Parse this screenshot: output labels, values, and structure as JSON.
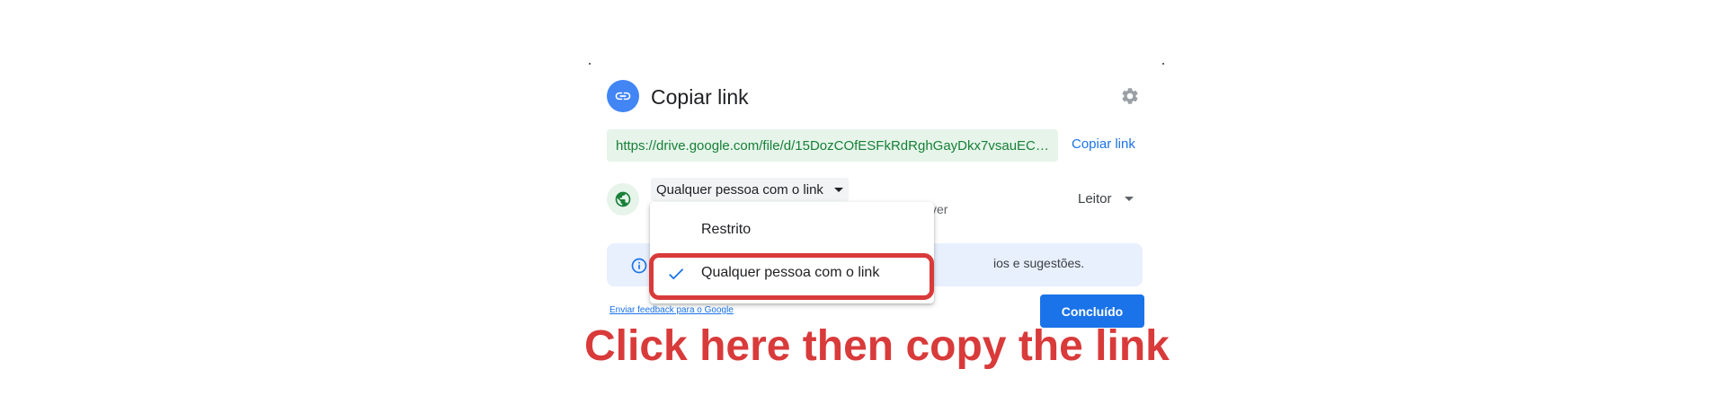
{
  "dialog": {
    "title": "Copiar link",
    "url": "https://drive.google.com/file/d/15DozCOfESFkRdRghGayDkx7vsauECU9X...",
    "copy_link_label": "Copiar link",
    "access_label": "Qualquer pessoa com o link",
    "access_description_fragment": "ver",
    "role_label": "Leitor",
    "info_text_fragment": "ios e sugestões.",
    "feedback_label": "Enviar feedback para o Google",
    "done_label": "Concluído"
  },
  "menu": {
    "items": [
      {
        "label": "Restrito",
        "selected": false
      },
      {
        "label": "Qualquer pessoa com o link",
        "selected": true
      }
    ]
  },
  "annotation": {
    "caption": "Click here then copy the link",
    "color": "#d93a3a"
  },
  "colors": {
    "accent": "#1a73e8",
    "link_green": "#188038",
    "globe_bg": "#e6f4ea"
  },
  "icons": {
    "title": "link-icon",
    "settings": "gear-icon",
    "globe": "globe-icon",
    "info": "info-icon",
    "check": "check-icon"
  }
}
